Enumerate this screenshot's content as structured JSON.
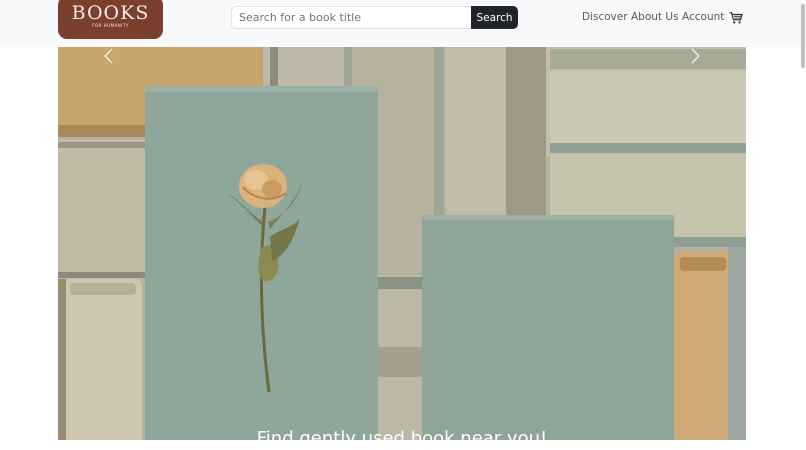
{
  "brand": {
    "name": "BOOKS",
    "tagline": "FOR HUMANITY"
  },
  "search": {
    "placeholder": "Search for a book title",
    "button_label": "Search"
  },
  "nav": {
    "discover": "Discover",
    "about": "About Us",
    "account": "Account"
  },
  "icons": {
    "cart": "cart-icon",
    "prev": "chevron-left-icon",
    "next": "chevron-right-icon"
  },
  "hero": {
    "caption": "Find gently used book near you!"
  },
  "colors": {
    "brand": "#7b3f2e",
    "search_button": "#212529",
    "navbar": "#f8f9fa",
    "card": "#8fa69a"
  }
}
